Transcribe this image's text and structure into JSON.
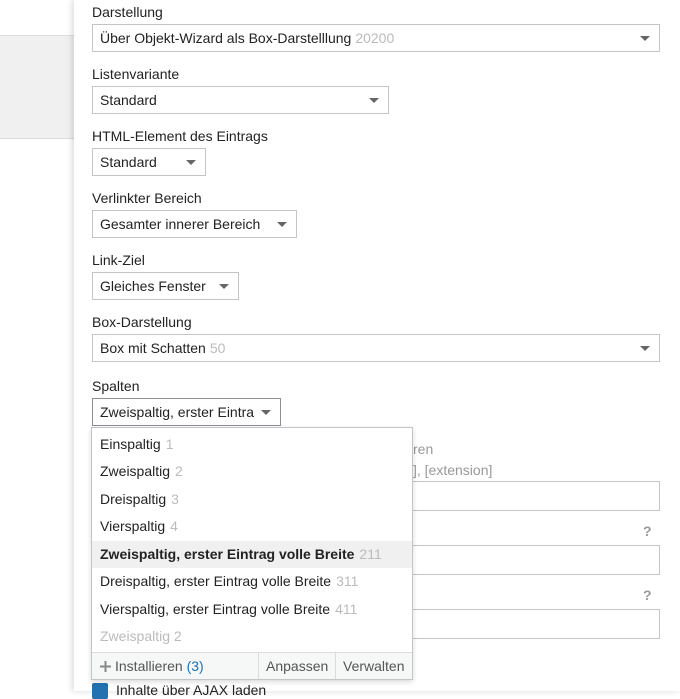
{
  "fields": {
    "darstellung": {
      "label": "Darstellung",
      "value": "Über Objekt-Wizard als Box-Darstelllung",
      "num": "20200"
    },
    "listenvariante": {
      "label": "Listenvariante",
      "value": "Standard"
    },
    "html_element": {
      "label": "HTML-Element des Eintrags",
      "value": "Standard"
    },
    "verlinkter_bereich": {
      "label": "Verlinkter Bereich",
      "value": "Gesamter innerer Bereich"
    },
    "link_ziel": {
      "label": "Link-Ziel",
      "value": "Gleiches Fenster"
    },
    "box_darstellung": {
      "label": "Box-Darstellung",
      "value": "Box mit Schatten",
      "num": "50"
    },
    "spalten": {
      "label": "Spalten",
      "value": "Zweispaltig, erster Eintra"
    }
  },
  "behind": {
    "text1": "ren",
    "text2": "], [extension]",
    "help1": "?",
    "help2": "?",
    "checkbox_label": "Inhalte über AJAX laden"
  },
  "dropdown": {
    "options": [
      {
        "label": "Einspaltig",
        "num": "1"
      },
      {
        "label": "Zweispaltig",
        "num": "2"
      },
      {
        "label": "Dreispaltig",
        "num": "3"
      },
      {
        "label": "Vierspaltig",
        "num": "4"
      },
      {
        "label": "Zweispaltig, erster Eintrag volle Breite",
        "num": "211"
      },
      {
        "label": "Dreispaltig, erster Eintrag volle Breite",
        "num": "311"
      },
      {
        "label": "Vierspaltig, erster Eintrag volle Breite",
        "num": "411"
      },
      {
        "label": "Zweispaltig 2",
        "num": ""
      }
    ],
    "footer": {
      "install_label": "Installieren",
      "install_count": "(3)",
      "anpassen": "Anpassen",
      "verwalten": "Verwalten"
    }
  }
}
